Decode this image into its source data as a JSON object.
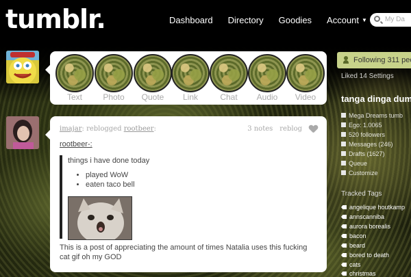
{
  "header": {
    "logo": "tumblr.",
    "nav": [
      "Dashboard",
      "Directory",
      "Goodies",
      "Account"
    ],
    "search_placeholder": "My Da"
  },
  "post_types": [
    {
      "label": "Text",
      "icon": "text-icon"
    },
    {
      "label": "Photo",
      "icon": "photo-icon"
    },
    {
      "label": "Quote",
      "icon": "quote-icon"
    },
    {
      "label": "Link",
      "icon": "link-icon"
    },
    {
      "label": "Chat",
      "icon": "chat-icon"
    },
    {
      "label": "Audio",
      "icon": "audio-icon"
    },
    {
      "label": "Video",
      "icon": "video-icon"
    }
  ],
  "post": {
    "reblogger": "imajar",
    "reblogged_text": "reblogged",
    "original": "rootbeer",
    "notes": "3 notes",
    "reblog_label": "reblog",
    "source": "rootbeer-:",
    "quote_text": "things i have done today",
    "list": [
      "played WoW",
      "eaten taco bell"
    ],
    "caption": "This is a post of appreciating the amount of times Natalia uses this fucking cat gif oh my GOD"
  },
  "sidebar": {
    "following": "Following 311 peo",
    "liked": "Liked 14 Settings",
    "blog_name": "tanga dinga dum",
    "blog_items": [
      "Mega Dreams tumb",
      "Ego: 1.0065",
      "520 followers",
      "Messages (246)",
      "Drafts (1627)",
      "Queue",
      "Customize"
    ],
    "tracked_title": "Tracked Tags",
    "tags": [
      "angelique houtkamp",
      "annscanniba",
      "aurora borealis",
      "bacon",
      "beard",
      "bored to death",
      "cats",
      "christmas"
    ]
  },
  "colors": {
    "following_bg": "#c7d28a",
    "panel_bg": "#ffffff"
  }
}
